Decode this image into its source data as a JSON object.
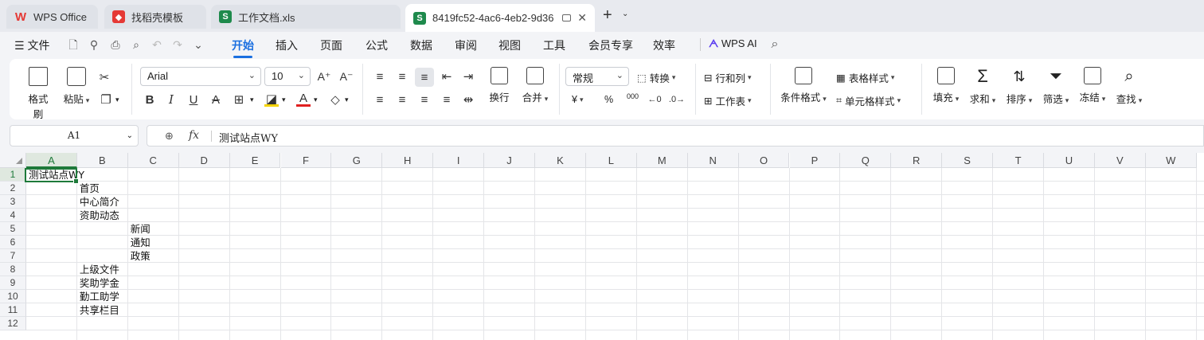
{
  "tabs": [
    {
      "label": "WPS Office",
      "icon": "wps-logo-icon",
      "color": "#e53935"
    },
    {
      "label": "找稻壳模板",
      "icon": "docer-icon",
      "color": "#e53935"
    },
    {
      "label": "工作文档.xls",
      "icon": "spreadsheet-icon",
      "color": "#1e8a4c"
    },
    {
      "label": "8419fc52-4ac6-4eb2-9d36",
      "icon": "spreadsheet-icon",
      "color": "#1e8a4c"
    }
  ],
  "menu": {
    "file": "文件",
    "items": [
      "开始",
      "插入",
      "页面",
      "公式",
      "数据",
      "审阅",
      "视图",
      "工具",
      "会员专享",
      "效率"
    ],
    "active": "开始",
    "wps_ai": "WPS AI"
  },
  "ribbon": {
    "format_painter": "格式刷",
    "paste": "粘贴",
    "font_name": "Arial",
    "font_size": "10",
    "wrap": "换行",
    "merge": "合并",
    "number_format": "常规",
    "convert": "转换",
    "rows_cols": "行和列",
    "worksheet": "工作表",
    "cond_format": "条件格式",
    "table_style": "表格样式",
    "cell_style": "单元格样式",
    "fill": "填充",
    "sum": "求和",
    "sort": "排序",
    "filter": "筛选",
    "freeze": "冻结",
    "find": "查找",
    "currency": "¥",
    "percent": "%",
    "thousands": "000"
  },
  "formula_bar": {
    "name_box": "A1",
    "fx": "fx",
    "value": "测试站点WY"
  },
  "sheet": {
    "columns": [
      "A",
      "B",
      "C",
      "D",
      "E",
      "F",
      "G",
      "H",
      "I",
      "J",
      "K",
      "L",
      "M",
      "N",
      "O",
      "P",
      "Q",
      "R",
      "S",
      "T",
      "U",
      "V",
      "W"
    ],
    "rows": [
      "1",
      "2",
      "3",
      "4",
      "5",
      "6",
      "7",
      "8",
      "9",
      "10",
      "11",
      "12"
    ],
    "cells": [
      {
        "ref": "A1",
        "text": "测试站点WY"
      },
      {
        "ref": "B2",
        "text": "首页"
      },
      {
        "ref": "B3",
        "text": "中心简介"
      },
      {
        "ref": "B4",
        "text": "资助动态"
      },
      {
        "ref": "C5",
        "text": "新闻"
      },
      {
        "ref": "C6",
        "text": "通知"
      },
      {
        "ref": "C7",
        "text": "政策"
      },
      {
        "ref": "B8",
        "text": "上级文件"
      },
      {
        "ref": "B9",
        "text": "奖助学金"
      },
      {
        "ref": "B10",
        "text": "勤工助学"
      },
      {
        "ref": "B11",
        "text": "共享栏目"
      }
    ]
  },
  "colors": {
    "accent": "#1a6fe0",
    "sheet_green": "#1e7a3a"
  }
}
